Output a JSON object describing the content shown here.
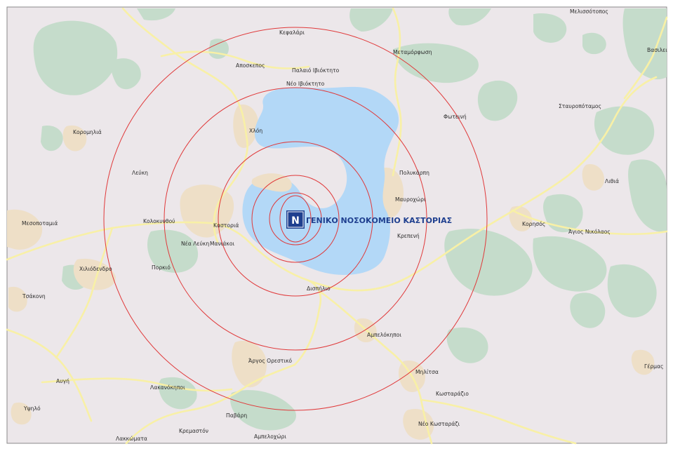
{
  "map": {
    "hospital": {
      "label": "ΓΕΝΙΚΟ ΝΟΣΟΚΟΜΕΙΟ ΚΑΣΤΟΡΙΑΣ",
      "marker_letter": "N",
      "marker_color": "#1f3f8f"
    },
    "radius_ring_color": "#e0393a",
    "radius_ring_count": 6,
    "colors": {
      "background": "#ece7ea",
      "water": "#b3d8f7",
      "forest": "#c5dccb",
      "road": "#f8f0a6",
      "settlement": "#eedfc7"
    },
    "places": {
      "kefalari": "Κεφαλάρι",
      "metamorfosi": "Μεταμόρφωση",
      "melissotopos": "Μελισσότοπος",
      "vasiliada": "Βασιλει",
      "aposkepos": "Αποσκεπος",
      "palaio_ivioktito": "Παλαιό Ιβιόκτητο",
      "neo_ivioktito": "Νέο Ιβιόκτητο",
      "stavropotamos": "Σταυροπόταμος",
      "foteini": "Φωτεινή",
      "chloi": "Χλόη",
      "koromilia": "Κορομηλιά",
      "lefki": "Λεύκη",
      "polykarpi": "Πολυκάρπη",
      "lithia": "Λιθιά",
      "mavrochori": "Μαυροχώρι",
      "mesopotamia": "Μεσοποταμιά",
      "kolokynthou": "Κολοκυνθού",
      "kastoria": "Καστοριά",
      "korisos": "Κορησός",
      "agios_nikolaos": "Άγιος Νικόλαος",
      "krepeni": "Κρεπενή",
      "nea_lefki": "Νέα Λεύκη",
      "maniakoi": "Μανιάκοι",
      "chiliodendro": "Χιλιόδενδρο",
      "porkio": "Πορκιό",
      "dispilio": "Δισπήλιο",
      "tsakoni": "Τσάκονη",
      "ampelokipoi": "Αμπελόκηποι",
      "argos_orestiko": "Άργος Ορεστικό",
      "militsa": "Μηλίτσα",
      "germas": "Γέρμας",
      "avgi": "Αυγή",
      "lakanokipoi": "Λακανόκηποι",
      "kostarazio": "Κωσταράζιο",
      "ypsilo": "Υψηλό",
      "pavrdi": "Παβάρη",
      "neo_kostarazi": "Νέο Κωσταράζι",
      "kremaston": "Κρεμαστόν",
      "lakkomata": "Λακκώματα",
      "ampelochori": "Αμπελοχώρι"
    }
  }
}
